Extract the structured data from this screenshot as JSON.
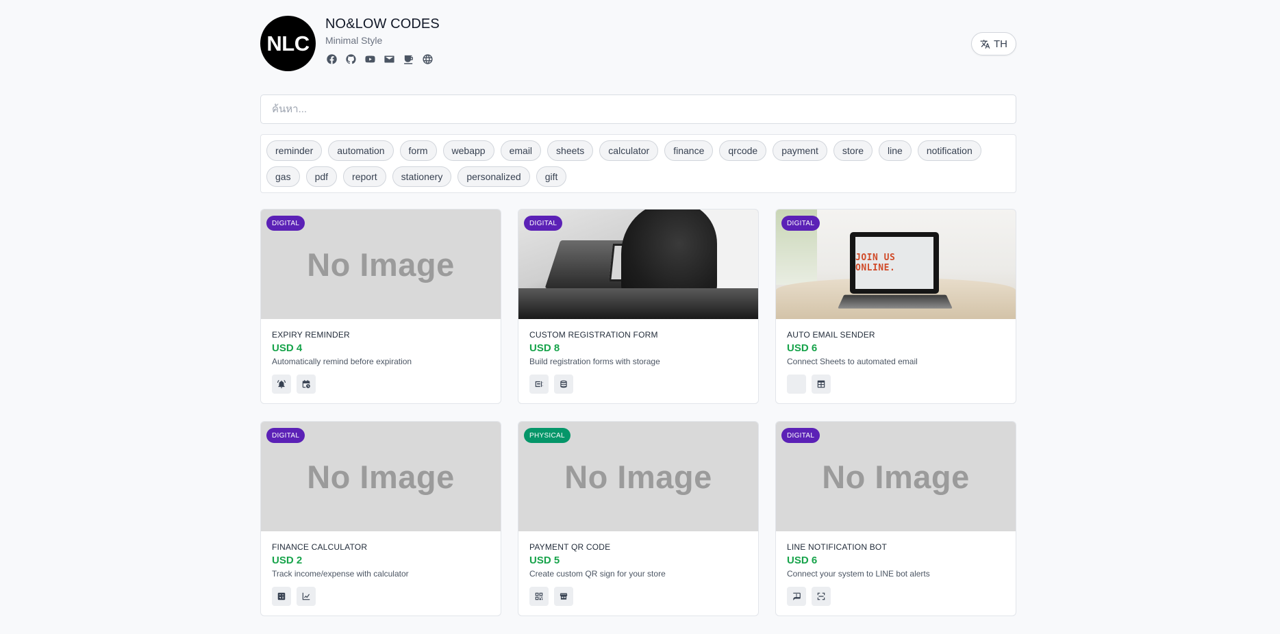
{
  "header": {
    "logo_text": "NLC",
    "title": "NO&LOW CODES",
    "subtitle": "Minimal Style",
    "socials": [
      "facebook-icon",
      "github-icon",
      "youtube-icon",
      "mail-icon",
      "coffee-icon",
      "globe-icon"
    ],
    "lang_label": "TH"
  },
  "search": {
    "placeholder": "ค้นหา..."
  },
  "tags": [
    "reminder",
    "automation",
    "form",
    "webapp",
    "email",
    "sheets",
    "calculator",
    "finance",
    "qrcode",
    "payment",
    "store",
    "line",
    "notification",
    "gas",
    "pdf",
    "report",
    "stationery",
    "personalized",
    "gift"
  ],
  "no_image_text": "No Image",
  "products": [
    {
      "badge": "DIGITAL",
      "title": "EXPIRY REMINDER",
      "price": "USD 4",
      "desc": "Automatically remind before expiration",
      "icons": [
        "bell-icon",
        "calendar-clock-icon"
      ]
    },
    {
      "badge": "DIGITAL",
      "title": "CUSTOM REGISTRATION FORM",
      "price": "USD 8",
      "desc": "Build registration forms with storage",
      "icons": [
        "form-icon",
        "database-icon"
      ]
    },
    {
      "badge": "DIGITAL",
      "title": "AUTO EMAIL SENDER",
      "price": "USD 6",
      "desc": "Connect Sheets to automated email",
      "icons": [
        "blank-icon",
        "table-icon"
      ],
      "screen_text": "JOIN US ONLINE."
    },
    {
      "badge": "DIGITAL",
      "title": "FINANCE CALCULATOR",
      "price": "USD 2",
      "desc": "Track income/expense with calculator",
      "icons": [
        "calculator-icon",
        "chart-line-icon"
      ]
    },
    {
      "badge": "PHYSICAL",
      "title": "PAYMENT QR CODE",
      "price": "USD 5",
      "desc": "Create custom QR sign for your store",
      "icons": [
        "qrcode-icon",
        "store-icon"
      ]
    },
    {
      "badge": "DIGITAL",
      "title": "LINE NOTIFICATION BOT",
      "price": "USD 6",
      "desc": "Connect your system to LINE bot alerts",
      "icons": [
        "message-icon",
        "scan-icon"
      ]
    }
  ]
}
